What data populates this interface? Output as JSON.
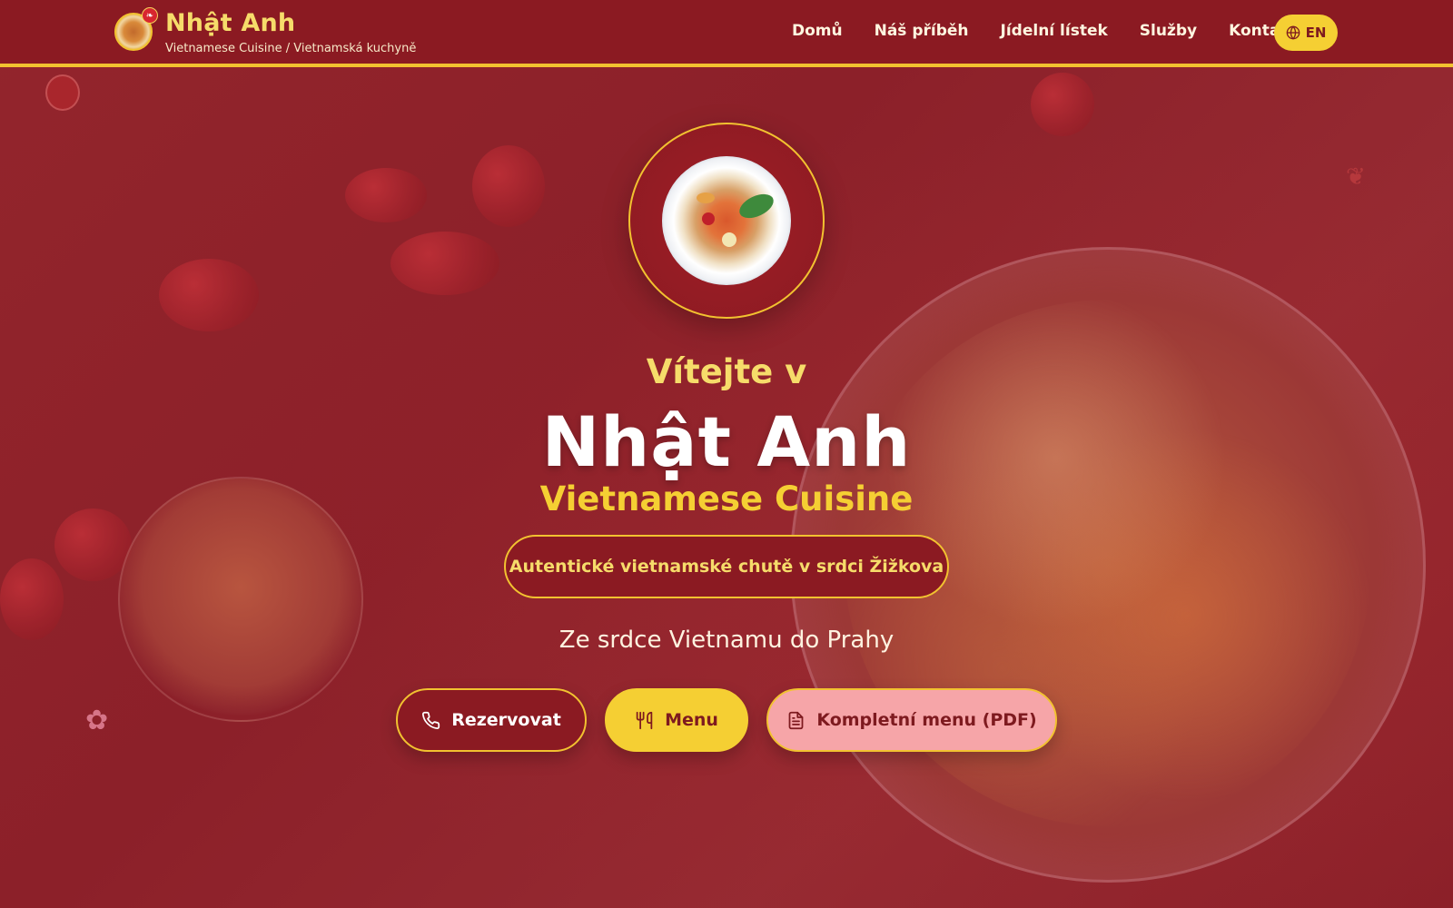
{
  "header": {
    "brand_name": "Nhật Anh",
    "brand_subtitle": "Vietnamese Cuisine / Vietnamská kuchyně",
    "logo_icon": "noodle-bowl-icon",
    "logo_badge_icon": "leaf-icon",
    "nav": [
      {
        "label": "Domů"
      },
      {
        "label": "Náš příběh"
      },
      {
        "label": "Jídelní lístek"
      },
      {
        "label": "Služby"
      },
      {
        "label": "Kontakt"
      }
    ],
    "language_button": {
      "label": "EN",
      "icon": "globe-icon"
    }
  },
  "hero": {
    "welcome": "Vítejte v",
    "title": "Nhật Anh",
    "subtitle": "Vietnamese Cuisine",
    "tag": "Autentické vietnamské chutě v srdci Žižkova",
    "tagline": "Ze srdce Vietnamu do Prahy",
    "emblem_icon": "pho-bowl-icon",
    "buttons": {
      "reserve": {
        "label": "Rezervovat",
        "icon": "phone-icon"
      },
      "menu": {
        "label": "Menu",
        "icon": "utensils-icon"
      },
      "pdf": {
        "label": "Kompletní menu (PDF)",
        "icon": "document-icon"
      }
    }
  },
  "colors": {
    "primary_red": "#8b1a22",
    "accent_yellow": "#f5cf33",
    "pink": "#f6a5a8",
    "text_light": "#fff3e0"
  }
}
